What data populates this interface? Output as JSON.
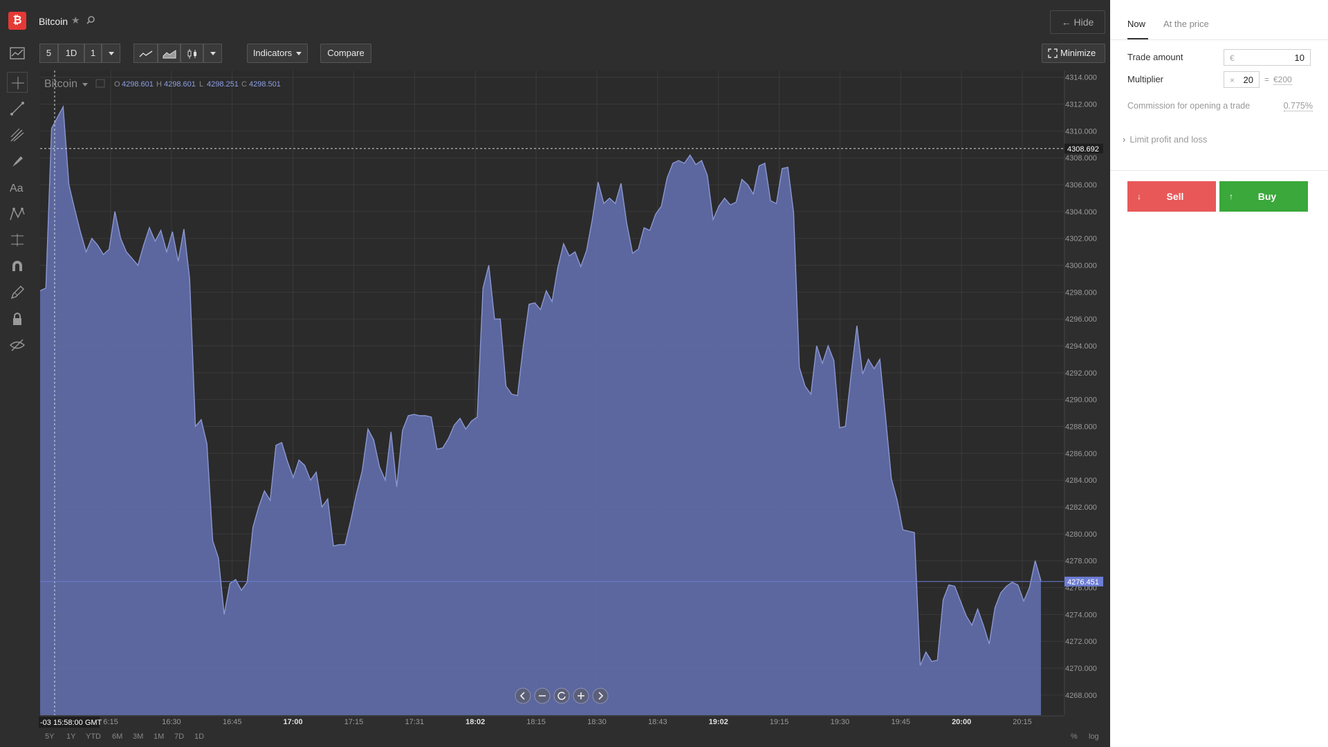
{
  "app": {
    "logo_glyph": "₿",
    "title": "Bitcoin",
    "hide_label": "← Hide"
  },
  "toolbar": {
    "interval_a": "5",
    "interval_b": "1D",
    "interval_c": "1",
    "indicators_label": "Indicators",
    "compare_label": "Compare",
    "minimize_label": "Minimize"
  },
  "chart_header": {
    "symbol": "Bitcoin",
    "open_label": "O",
    "open": "4298.601",
    "high_label": "H",
    "high": "4298.601",
    "low_label": "L",
    "low": "4298.251",
    "close_label": "C",
    "close": "4298.501"
  },
  "crosshair": {
    "price_label": "4308.692",
    "time_label": "-03 15:58:00 GMT"
  },
  "last_price_label": "4276.451",
  "range_buttons": [
    "5Y",
    "1Y",
    "YTD",
    "6M",
    "3M",
    "1M",
    "7D",
    "1D"
  ],
  "scale_buttons": [
    "%",
    "log"
  ],
  "chart_data": {
    "type": "area",
    "title": "",
    "xlabel": "",
    "ylabel": "",
    "ylim": [
      4266.5,
      4314.5
    ],
    "y_ticks": [
      "4314.000",
      "4312.000",
      "4310.000",
      "4308.000",
      "4306.000",
      "4304.000",
      "4302.000",
      "4300.000",
      "4298.000",
      "4296.000",
      "4294.000",
      "4292.000",
      "4290.000",
      "4288.000",
      "4286.000",
      "4284.000",
      "4282.000",
      "4280.000",
      "4278.000",
      "4276.000",
      "4274.000",
      "4272.000",
      "4270.000",
      "4268.000"
    ],
    "x_ticks": [
      {
        "label": "6:15",
        "bold": false
      },
      {
        "label": "16:30",
        "bold": false
      },
      {
        "label": "16:45",
        "bold": false
      },
      {
        "label": "17:00",
        "bold": true
      },
      {
        "label": "17:15",
        "bold": false
      },
      {
        "label": "17:31",
        "bold": false
      },
      {
        "label": "18:02",
        "bold": true
      },
      {
        "label": "18:15",
        "bold": false
      },
      {
        "label": "18:30",
        "bold": false
      },
      {
        "label": "18:43",
        "bold": false
      },
      {
        "label": "19:02",
        "bold": true
      },
      {
        "label": "19:15",
        "bold": false
      },
      {
        "label": "19:30",
        "bold": false
      },
      {
        "label": "19:45",
        "bold": false
      },
      {
        "label": "20:00",
        "bold": true
      },
      {
        "label": "20:15",
        "bold": false
      }
    ],
    "series": [
      {
        "values": [
          4298.1,
          4298.3,
          4310.2,
          4311.0,
          4311.8,
          4306.0,
          4304.2,
          4302.5,
          4301.0,
          4302.0,
          4301.5,
          4300.8,
          4301.2,
          4304.0,
          4302.0,
          4301.0,
          4300.5,
          4300.0,
          4301.5,
          4302.8,
          4301.8,
          4302.6,
          4301.0,
          4302.5,
          4300.3,
          4302.7,
          4299.0,
          4288.0,
          4288.5,
          4286.7,
          4279.5,
          4278.2,
          4274.0,
          4276.3,
          4276.6,
          4275.8,
          4276.4,
          4280.5,
          4282.0,
          4283.2,
          4282.5,
          4286.6,
          4286.8,
          4285.4,
          4284.2,
          4285.5,
          4285.1,
          4284.0,
          4284.6,
          4282.0,
          4282.6,
          4279.1,
          4279.2,
          4279.2,
          4281.0,
          4283.0,
          4284.7,
          4287.8,
          4287.0,
          4285.0,
          4284.0,
          4287.6,
          4283.5,
          4287.7,
          4288.8,
          4288.9,
          4288.8,
          4288.8,
          4288.7,
          4286.3,
          4286.4,
          4287.1,
          4288.1,
          4288.6,
          4287.8,
          4288.4,
          4288.7,
          4298.3,
          4300.0,
          4296.0,
          4296.0,
          4291.0,
          4290.4,
          4290.3,
          4294.0,
          4297.1,
          4297.2,
          4296.7,
          4298.1,
          4297.3,
          4299.8,
          4301.6,
          4300.7,
          4301.0,
          4299.9,
          4301.1,
          4303.4,
          4306.2,
          4304.6,
          4305.0,
          4304.6,
          4306.1,
          4303.1,
          4300.9,
          4301.2,
          4302.8,
          4302.6,
          4303.8,
          4304.4,
          4306.5,
          4307.6,
          4307.8,
          4307.6,
          4308.2,
          4307.5,
          4307.8,
          4306.7,
          4303.4,
          4304.4,
          4305.0,
          4304.5,
          4304.7,
          4306.4,
          4306.0,
          4305.3,
          4307.4,
          4307.6,
          4304.8,
          4304.6,
          4307.2,
          4307.3,
          4303.9,
          4292.4,
          4291.0,
          4290.4,
          4294.0,
          4292.7,
          4294.0,
          4292.9,
          4287.9,
          4288.0,
          4291.9,
          4295.5,
          4291.9,
          4293.0,
          4292.3,
          4293.0,
          4288.6,
          4284.1,
          4282.5,
          4280.3,
          4280.2,
          4280.1,
          4270.2,
          4271.2,
          4270.5,
          4270.6,
          4275.1,
          4276.2,
          4276.1,
          4275.0,
          4273.9,
          4273.2,
          4274.4,
          4273.2,
          4271.8,
          4274.5,
          4275.6,
          4276.1,
          4276.4,
          4276.2,
          4275.0,
          4276.0,
          4278.0,
          4276.5
        ]
      }
    ]
  },
  "nav_controls": [
    "prev",
    "zoom-out",
    "reset",
    "zoom-in",
    "next"
  ],
  "panel": {
    "tab_now": "Now",
    "tab_at_price": "At the price",
    "trade_amount_label": "Trade amount",
    "currency_prefix": "€",
    "trade_amount_value": "10",
    "multiplier_label": "Multiplier",
    "multiplier_prefix": "×",
    "multiplier_value": "20",
    "equals": "=",
    "multiplied_value": "€200",
    "commission_label": "Commission for opening a trade",
    "commission_value": "0.775%",
    "limit_label": "Limit profit and loss",
    "sell_label": "Sell",
    "buy_label": "Buy"
  },
  "colors": {
    "area_fill": "#5e6aa4",
    "area_line": "#8c97d2",
    "sell": "#e85858",
    "buy": "#3aa83a",
    "price_tag": "#6e7ed4"
  }
}
